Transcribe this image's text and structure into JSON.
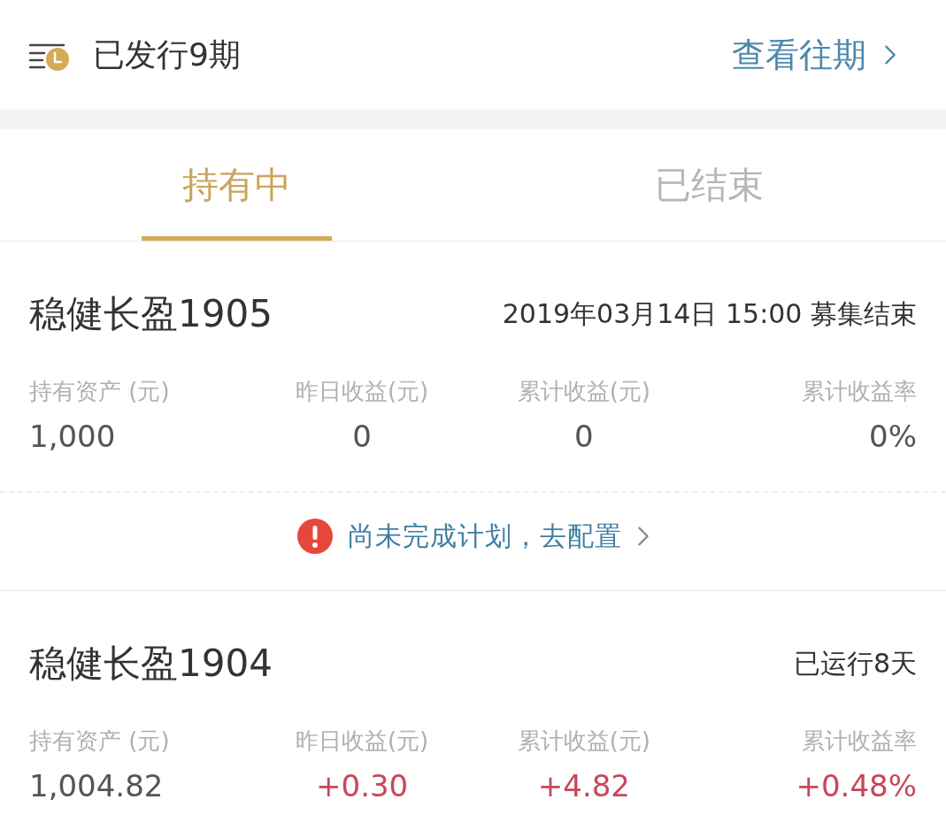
{
  "header": {
    "title": "已发行9期",
    "link": "查看往期"
  },
  "tabs": [
    {
      "label": "持有中",
      "selected": true
    },
    {
      "label": "已结束",
      "selected": false
    }
  ],
  "products": [
    {
      "name": "稳健长盈1905",
      "status": "2019年03月14日 15:00 募集结束",
      "metrics": [
        {
          "label": "持有资产 (元)",
          "value": "1,000",
          "gain": false
        },
        {
          "label": "昨日收益(元)",
          "value": "0",
          "gain": false
        },
        {
          "label": "累计收益(元)",
          "value": "0",
          "gain": false
        },
        {
          "label": "累计收益率",
          "value": "0%",
          "gain": false
        }
      ],
      "notice": "尚未完成计划，去配置"
    },
    {
      "name": "稳健长盈1904",
      "status": "已运行8天",
      "metrics": [
        {
          "label": "持有资产 (元)",
          "value": "1,004.82",
          "gain": false
        },
        {
          "label": "昨日收益(元)",
          "value": "+0.30",
          "gain": true
        },
        {
          "label": "累计收益(元)",
          "value": "+4.82",
          "gain": true
        },
        {
          "label": "累计收益率",
          "value": "+0.48%",
          "gain": true
        }
      ]
    }
  ]
}
